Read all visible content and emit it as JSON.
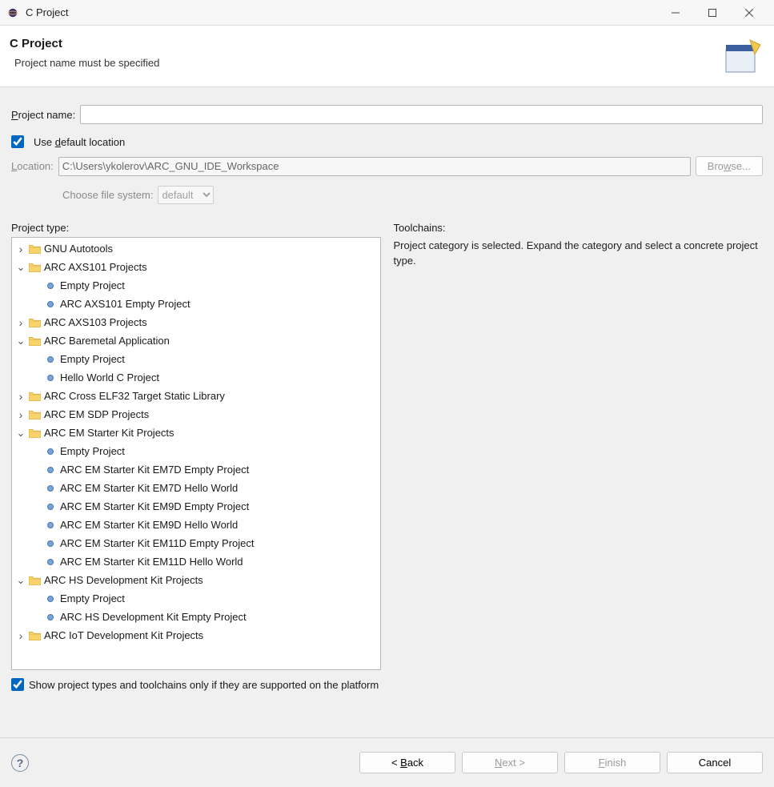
{
  "titlebar": {
    "title": "C Project"
  },
  "header": {
    "title": "C Project",
    "subtitle": "Project name must be specified"
  },
  "form": {
    "projectName": {
      "underline": "P",
      "rest": "roject name:",
      "value": ""
    },
    "useDefault": {
      "pre": "Use ",
      "underline": "d",
      "post": "efault location"
    },
    "location": {
      "underline": "L",
      "rest": "ocation:",
      "value": "C:\\Users\\ykolerov\\ARC_GNU_IDE_Workspace"
    },
    "browse": {
      "pre": "Bro",
      "underline": "w",
      "post": "se..."
    },
    "fileSystem": {
      "label": "Choose file system:",
      "value": "default"
    }
  },
  "tree": {
    "label": "Project type:",
    "nodes": [
      {
        "depth": 0,
        "kind": "folder",
        "expanded": false,
        "label": "GNU Autotools"
      },
      {
        "depth": 0,
        "kind": "folder",
        "expanded": true,
        "label": "ARC AXS101 Projects"
      },
      {
        "depth": 1,
        "kind": "project",
        "label": "Empty Project"
      },
      {
        "depth": 1,
        "kind": "project",
        "label": "ARC AXS101 Empty Project"
      },
      {
        "depth": 0,
        "kind": "folder",
        "expanded": false,
        "label": "ARC AXS103 Projects"
      },
      {
        "depth": 0,
        "kind": "folder",
        "expanded": true,
        "label": "ARC Baremetal Application"
      },
      {
        "depth": 1,
        "kind": "project",
        "label": "Empty Project"
      },
      {
        "depth": 1,
        "kind": "project",
        "label": "Hello World C Project"
      },
      {
        "depth": 0,
        "kind": "folder",
        "expanded": false,
        "label": "ARC Cross ELF32 Target Static Library"
      },
      {
        "depth": 0,
        "kind": "folder",
        "expanded": false,
        "label": "ARC EM SDP Projects"
      },
      {
        "depth": 0,
        "kind": "folder",
        "expanded": true,
        "label": "ARC EM Starter Kit Projects"
      },
      {
        "depth": 1,
        "kind": "project",
        "label": "Empty Project"
      },
      {
        "depth": 1,
        "kind": "project",
        "label": "ARC EM Starter Kit EM7D Empty Project"
      },
      {
        "depth": 1,
        "kind": "project",
        "label": "ARC EM Starter Kit EM7D Hello World"
      },
      {
        "depth": 1,
        "kind": "project",
        "label": "ARC EM Starter Kit EM9D Empty Project"
      },
      {
        "depth": 1,
        "kind": "project",
        "label": "ARC EM Starter Kit EM9D Hello World"
      },
      {
        "depth": 1,
        "kind": "project",
        "label": "ARC EM Starter Kit EM11D Empty Project"
      },
      {
        "depth": 1,
        "kind": "project",
        "label": "ARC EM Starter Kit EM11D Hello World"
      },
      {
        "depth": 0,
        "kind": "folder",
        "expanded": true,
        "label": "ARC HS Development Kit Projects"
      },
      {
        "depth": 1,
        "kind": "project",
        "label": "Empty Project"
      },
      {
        "depth": 1,
        "kind": "project",
        "label": "ARC HS Development Kit Empty Project"
      },
      {
        "depth": 0,
        "kind": "folder",
        "expanded": false,
        "label": "ARC IoT Development Kit Projects"
      }
    ]
  },
  "toolchains": {
    "label": "Toolchains:",
    "message": "Project category is selected. Expand the category and select a concrete project type."
  },
  "filter": {
    "label": "Show project types and toolchains only if they are supported on the platform"
  },
  "buttons": {
    "back": {
      "pre": "< ",
      "underline": "B",
      "post": "ack"
    },
    "next": {
      "underline": "N",
      "post": "ext >"
    },
    "finish": {
      "underline": "F",
      "post": "inish"
    },
    "cancel": "Cancel"
  }
}
